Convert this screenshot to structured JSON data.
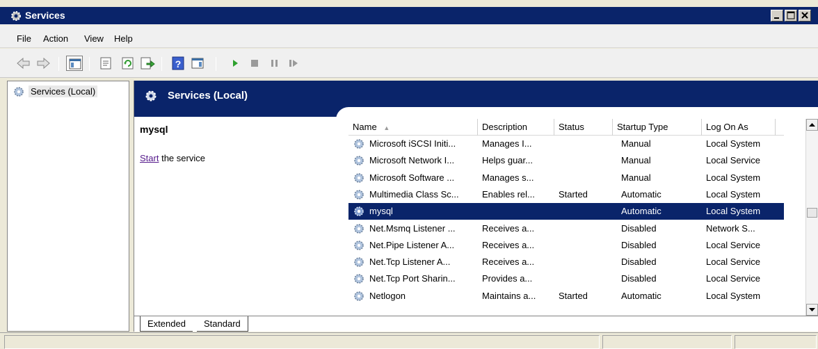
{
  "window": {
    "title": "Services"
  },
  "menu": {
    "file": "File",
    "action": "Action",
    "view": "View",
    "help": "Help"
  },
  "tree": {
    "item": "Services (Local)"
  },
  "header": {
    "title": "Services (Local)"
  },
  "details": {
    "service_name": "mysql",
    "action_link": "Start",
    "action_suffix": " the service"
  },
  "list": {
    "columns": {
      "name": "Name",
      "description": "Description",
      "status": "Status",
      "startup": "Startup Type",
      "logon": "Log On As"
    },
    "sort_indicator": "▲",
    "rows": [
      {
        "name": "Microsoft iSCSI Initi...",
        "description": "Manages I...",
        "status": "",
        "startup": "Manual",
        "logon": "Local System"
      },
      {
        "name": "Microsoft Network I...",
        "description": "Helps guar...",
        "status": "",
        "startup": "Manual",
        "logon": "Local Service"
      },
      {
        "name": "Microsoft Software ...",
        "description": "Manages s...",
        "status": "",
        "startup": "Manual",
        "logon": "Local System"
      },
      {
        "name": "Multimedia Class Sc...",
        "description": "Enables rel...",
        "status": "Started",
        "startup": "Automatic",
        "logon": "Local System"
      },
      {
        "name": "mysql",
        "description": "",
        "status": "",
        "startup": "Automatic",
        "logon": "Local System",
        "selected": true
      },
      {
        "name": "Net.Msmq Listener ...",
        "description": "Receives a...",
        "status": "",
        "startup": "Disabled",
        "logon": "Network S..."
      },
      {
        "name": "Net.Pipe Listener A...",
        "description": "Receives a...",
        "status": "",
        "startup": "Disabled",
        "logon": "Local Service"
      },
      {
        "name": "Net.Tcp Listener A...",
        "description": "Receives a...",
        "status": "",
        "startup": "Disabled",
        "logon": "Local Service"
      },
      {
        "name": "Net.Tcp Port Sharin...",
        "description": "Provides a...",
        "status": "",
        "startup": "Disabled",
        "logon": "Local Service"
      },
      {
        "name": "Netlogon",
        "description": "Maintains a...",
        "status": "Started",
        "startup": "Automatic",
        "logon": "Local System"
      }
    ]
  },
  "tabs": {
    "extended": "Extended",
    "standard": "Standard"
  },
  "colors": {
    "title_bar": "#0a246a",
    "selection": "#0a246a",
    "link": "#551a8b"
  },
  "icons": [
    "services-gear-icon",
    "back-arrow-icon",
    "forward-arrow-icon",
    "show-hide-tree-icon",
    "properties-icon",
    "refresh-icon",
    "export-list-icon",
    "help-icon",
    "action-pane-icon",
    "start-service-icon",
    "stop-service-icon",
    "pause-service-icon",
    "resume-service-icon"
  ]
}
